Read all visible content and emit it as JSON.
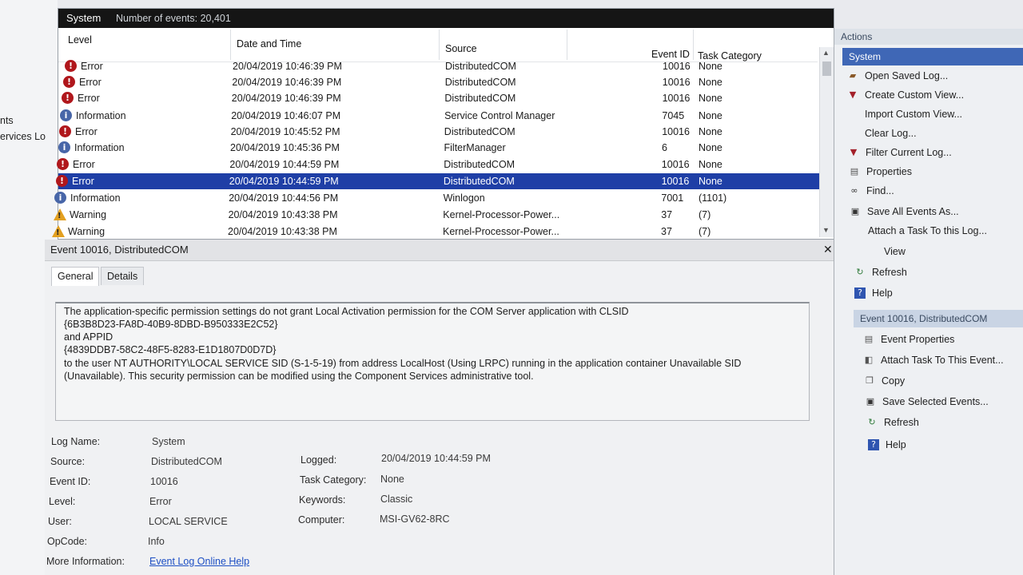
{
  "left_tree": {
    "items": [
      "nts",
      "ervices Lo"
    ]
  },
  "list": {
    "log_name": "System",
    "event_count": "Number of events: 20,401",
    "columns": {
      "level": "Level",
      "datetime": "Date and Time",
      "source": "Source",
      "event_id": "Event ID",
      "task_category": "Task Category"
    },
    "rows": [
      {
        "level": "Error",
        "icon": "error-icon",
        "datetime": "20/04/2019 10:46:39 PM",
        "source": "DistributedCOM",
        "event_id": "10016",
        "task": "None"
      },
      {
        "level": "Error",
        "icon": "error-icon",
        "datetime": "20/04/2019 10:46:39 PM",
        "source": "DistributedCOM",
        "event_id": "10016",
        "task": "None"
      },
      {
        "level": "Error",
        "icon": "error-icon",
        "datetime": "20/04/2019 10:46:39 PM",
        "source": "DistributedCOM",
        "event_id": "10016",
        "task": "None"
      },
      {
        "level": "Information",
        "icon": "information-icon",
        "datetime": "20/04/2019 10:46:07 PM",
        "source": "Service Control Manager",
        "event_id": "7045",
        "task": "None"
      },
      {
        "level": "Error",
        "icon": "error-icon",
        "datetime": "20/04/2019 10:45:52 PM",
        "source": "DistributedCOM",
        "event_id": "10016",
        "task": "None"
      },
      {
        "level": "Information",
        "icon": "information-icon",
        "datetime": "20/04/2019 10:45:36 PM",
        "source": "FilterManager",
        "event_id": "6",
        "task": "None"
      },
      {
        "level": "Error",
        "icon": "error-icon",
        "datetime": "20/04/2019 10:44:59 PM",
        "source": "DistributedCOM",
        "event_id": "10016",
        "task": "None"
      },
      {
        "level": "Error",
        "icon": "error-icon",
        "datetime": "20/04/2019 10:44:59 PM",
        "source": "DistributedCOM",
        "event_id": "10016",
        "task": "None",
        "selected": true
      },
      {
        "level": "Information",
        "icon": "information-icon",
        "datetime": "20/04/2019 10:44:56 PM",
        "source": "Winlogon",
        "event_id": "7001",
        "task": "(1101)"
      },
      {
        "level": "Warning",
        "icon": "warning-icon",
        "datetime": "20/04/2019 10:43:38 PM",
        "source": "Kernel-Processor-Power...",
        "event_id": "37",
        "task": "(7)"
      },
      {
        "level": "Warning",
        "icon": "warning-icon",
        "datetime": "20/04/2019 10:43:38 PM",
        "source": "Kernel-Processor-Power...",
        "event_id": "37",
        "task": "(7)"
      }
    ]
  },
  "detail": {
    "title": "Event 10016, DistributedCOM",
    "tabs": [
      "General",
      "Details"
    ],
    "message_lines": [
      "The application-specific permission settings do not grant Local Activation permission for the COM Server application with CLSID",
      "{6B3B8D23-FA8D-40B9-8DBD-B950333E2C52}",
      " and APPID",
      "{4839DDB7-58C2-48F5-8283-E1D1807D0D7D}",
      " to the user NT AUTHORITY\\LOCAL SERVICE SID (S-1-5-19) from address LocalHost (Using LRPC) running in the application container Unavailable SID",
      "(Unavailable). This security permission can be modified using the Component Services administrative tool."
    ],
    "fields": {
      "log_name_label": "Log Name:",
      "log_name": "System",
      "source_label": "Source:",
      "source": "DistributedCOM",
      "event_id_label": "Event ID:",
      "event_id": "10016",
      "level_label": "Level:",
      "level": "Error",
      "user_label": "User:",
      "user": "LOCAL SERVICE",
      "opcode_label": "OpCode:",
      "opcode": "Info",
      "more_info_label": "More Information:",
      "more_info_link": "Event Log Online Help",
      "logged_label": "Logged:",
      "logged": "20/04/2019 10:44:59 PM",
      "task_category_label": "Task Category:",
      "task_category": "None",
      "keywords_label": "Keywords:",
      "keywords": "Classic",
      "computer_label": "Computer:",
      "computer": "MSI-GV62-8RC"
    }
  },
  "actions": {
    "title": "Actions",
    "group_system": "System",
    "system_items": [
      {
        "label": "Open Saved Log...",
        "icon": "open-log-icon"
      },
      {
        "label": "Create Custom View...",
        "icon": "filter-icon"
      },
      {
        "label": "Import Custom View...",
        "icon": ""
      },
      {
        "label": "Clear Log...",
        "icon": ""
      },
      {
        "label": "Filter Current Log...",
        "icon": "filter-icon"
      },
      {
        "label": "Properties",
        "icon": "properties-icon"
      },
      {
        "label": "Find...",
        "icon": "binoculars-icon"
      },
      {
        "label": "Save All Events As...",
        "icon": "save-icon"
      },
      {
        "label": "Attach a Task To this Log...",
        "icon": ""
      },
      {
        "label": "View",
        "icon": ""
      },
      {
        "label": "Refresh",
        "icon": "refresh-icon"
      },
      {
        "label": "Help",
        "icon": "help-icon"
      }
    ],
    "group_event": "Event 10016, DistributedCOM",
    "event_items": [
      {
        "label": "Event Properties",
        "icon": "event-properties-icon"
      },
      {
        "label": "Attach Task To This Event...",
        "icon": "task-icon"
      },
      {
        "label": "Copy",
        "icon": "copy-icon"
      },
      {
        "label": "Save Selected Events...",
        "icon": "save-icon"
      },
      {
        "label": "Refresh",
        "icon": "refresh-icon"
      },
      {
        "label": "Help",
        "icon": "help-icon"
      }
    ]
  },
  "colors": {
    "selection": "#1f3fa6",
    "error": "#b0171c",
    "info": "#4866a8",
    "warning": "#e3a020",
    "header": "#151515"
  }
}
